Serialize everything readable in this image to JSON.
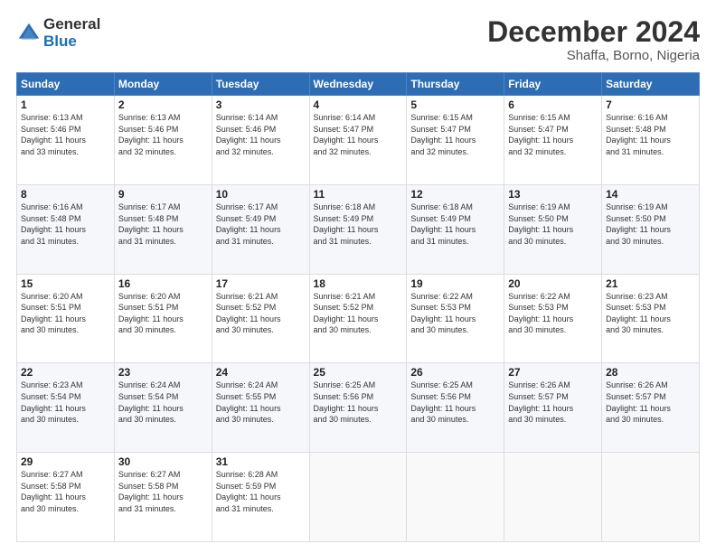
{
  "logo": {
    "general": "General",
    "blue": "Blue"
  },
  "header": {
    "month": "December 2024",
    "location": "Shaffa, Borno, Nigeria"
  },
  "days": [
    "Sunday",
    "Monday",
    "Tuesday",
    "Wednesday",
    "Thursday",
    "Friday",
    "Saturday"
  ],
  "weeks": [
    [
      {
        "num": "1",
        "rise": "6:13 AM",
        "set": "5:46 PM",
        "hours": "11",
        "mins": "33"
      },
      {
        "num": "2",
        "rise": "6:13 AM",
        "set": "5:46 PM",
        "hours": "11",
        "mins": "32"
      },
      {
        "num": "3",
        "rise": "6:14 AM",
        "set": "5:46 PM",
        "hours": "11",
        "mins": "32"
      },
      {
        "num": "4",
        "rise": "6:14 AM",
        "set": "5:47 PM",
        "hours": "11",
        "mins": "32"
      },
      {
        "num": "5",
        "rise": "6:15 AM",
        "set": "5:47 PM",
        "hours": "11",
        "mins": "32"
      },
      {
        "num": "6",
        "rise": "6:15 AM",
        "set": "5:47 PM",
        "hours": "11",
        "mins": "32"
      },
      {
        "num": "7",
        "rise": "6:16 AM",
        "set": "5:48 PM",
        "hours": "11",
        "mins": "31"
      }
    ],
    [
      {
        "num": "8",
        "rise": "6:16 AM",
        "set": "5:48 PM",
        "hours": "11",
        "mins": "31"
      },
      {
        "num": "9",
        "rise": "6:17 AM",
        "set": "5:48 PM",
        "hours": "11",
        "mins": "31"
      },
      {
        "num": "10",
        "rise": "6:17 AM",
        "set": "5:49 PM",
        "hours": "11",
        "mins": "31"
      },
      {
        "num": "11",
        "rise": "6:18 AM",
        "set": "5:49 PM",
        "hours": "11",
        "mins": "31"
      },
      {
        "num": "12",
        "rise": "6:18 AM",
        "set": "5:49 PM",
        "hours": "11",
        "mins": "31"
      },
      {
        "num": "13",
        "rise": "6:19 AM",
        "set": "5:50 PM",
        "hours": "11",
        "mins": "30"
      },
      {
        "num": "14",
        "rise": "6:19 AM",
        "set": "5:50 PM",
        "hours": "11",
        "mins": "30"
      }
    ],
    [
      {
        "num": "15",
        "rise": "6:20 AM",
        "set": "5:51 PM",
        "hours": "11",
        "mins": "30"
      },
      {
        "num": "16",
        "rise": "6:20 AM",
        "set": "5:51 PM",
        "hours": "11",
        "mins": "30"
      },
      {
        "num": "17",
        "rise": "6:21 AM",
        "set": "5:52 PM",
        "hours": "11",
        "mins": "30"
      },
      {
        "num": "18",
        "rise": "6:21 AM",
        "set": "5:52 PM",
        "hours": "11",
        "mins": "30"
      },
      {
        "num": "19",
        "rise": "6:22 AM",
        "set": "5:53 PM",
        "hours": "11",
        "mins": "30"
      },
      {
        "num": "20",
        "rise": "6:22 AM",
        "set": "5:53 PM",
        "hours": "11",
        "mins": "30"
      },
      {
        "num": "21",
        "rise": "6:23 AM",
        "set": "5:53 PM",
        "hours": "11",
        "mins": "30"
      }
    ],
    [
      {
        "num": "22",
        "rise": "6:23 AM",
        "set": "5:54 PM",
        "hours": "11",
        "mins": "30"
      },
      {
        "num": "23",
        "rise": "6:24 AM",
        "set": "5:54 PM",
        "hours": "11",
        "mins": "30"
      },
      {
        "num": "24",
        "rise": "6:24 AM",
        "set": "5:55 PM",
        "hours": "11",
        "mins": "30"
      },
      {
        "num": "25",
        "rise": "6:25 AM",
        "set": "5:56 PM",
        "hours": "11",
        "mins": "30"
      },
      {
        "num": "26",
        "rise": "6:25 AM",
        "set": "5:56 PM",
        "hours": "11",
        "mins": "30"
      },
      {
        "num": "27",
        "rise": "6:26 AM",
        "set": "5:57 PM",
        "hours": "11",
        "mins": "30"
      },
      {
        "num": "28",
        "rise": "6:26 AM",
        "set": "5:57 PM",
        "hours": "11",
        "mins": "30"
      }
    ],
    [
      {
        "num": "29",
        "rise": "6:27 AM",
        "set": "5:58 PM",
        "hours": "11",
        "mins": "30"
      },
      {
        "num": "30",
        "rise": "6:27 AM",
        "set": "5:58 PM",
        "hours": "11",
        "mins": "31"
      },
      {
        "num": "31",
        "rise": "6:28 AM",
        "set": "5:59 PM",
        "hours": "11",
        "mins": "31"
      },
      null,
      null,
      null,
      null
    ]
  ]
}
